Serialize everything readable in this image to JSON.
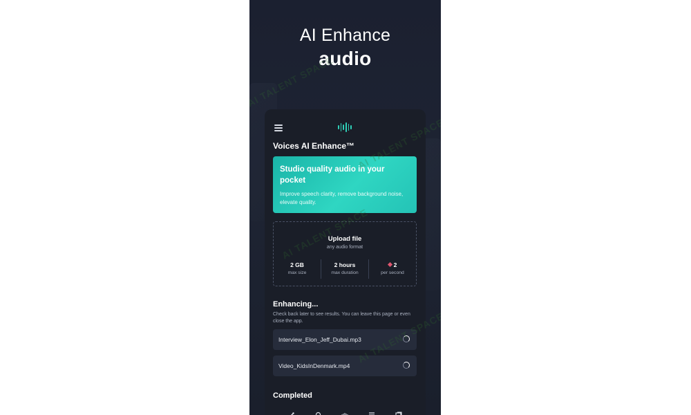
{
  "hero": {
    "line1": "AI Enhance",
    "line2": "audio"
  },
  "app": {
    "title": "Voices AI Enhance™",
    "promo": {
      "title": "Studio quality audio in your pocket",
      "description": "Improve speech clarity, remove background noise, elevate quality."
    },
    "upload": {
      "title": "Upload file",
      "subtitle": "any audio format",
      "stats": [
        {
          "value": "2 GB",
          "label": "max size"
        },
        {
          "value": "2 hours",
          "label": "max duration"
        },
        {
          "value": "2",
          "label": "per second"
        }
      ]
    },
    "enhancing": {
      "title": "Enhancing...",
      "description": "Check back later to see results. You can leave this page or even close the app.",
      "files": [
        {
          "name": "Interview_Elon_Jeff_Dubai.mp3"
        },
        {
          "name": "Video_KidsInDenmark.mp4"
        }
      ]
    },
    "completed": {
      "title": "Completed"
    }
  },
  "watermark": {
    "text": "AI TALENT SPACE"
  },
  "colors": {
    "accent": "#2fd0b8",
    "background": "#1a1e28",
    "card": "#262c3b",
    "gem": "#e0566f"
  },
  "icons": [
    "menu-icon",
    "waveform-logo-icon",
    "diamond-icon",
    "spinner-icon",
    "nav-enhance-icon",
    "nav-search-icon",
    "nav-audio-icon",
    "nav-list-icon",
    "nav-library-icon"
  ]
}
